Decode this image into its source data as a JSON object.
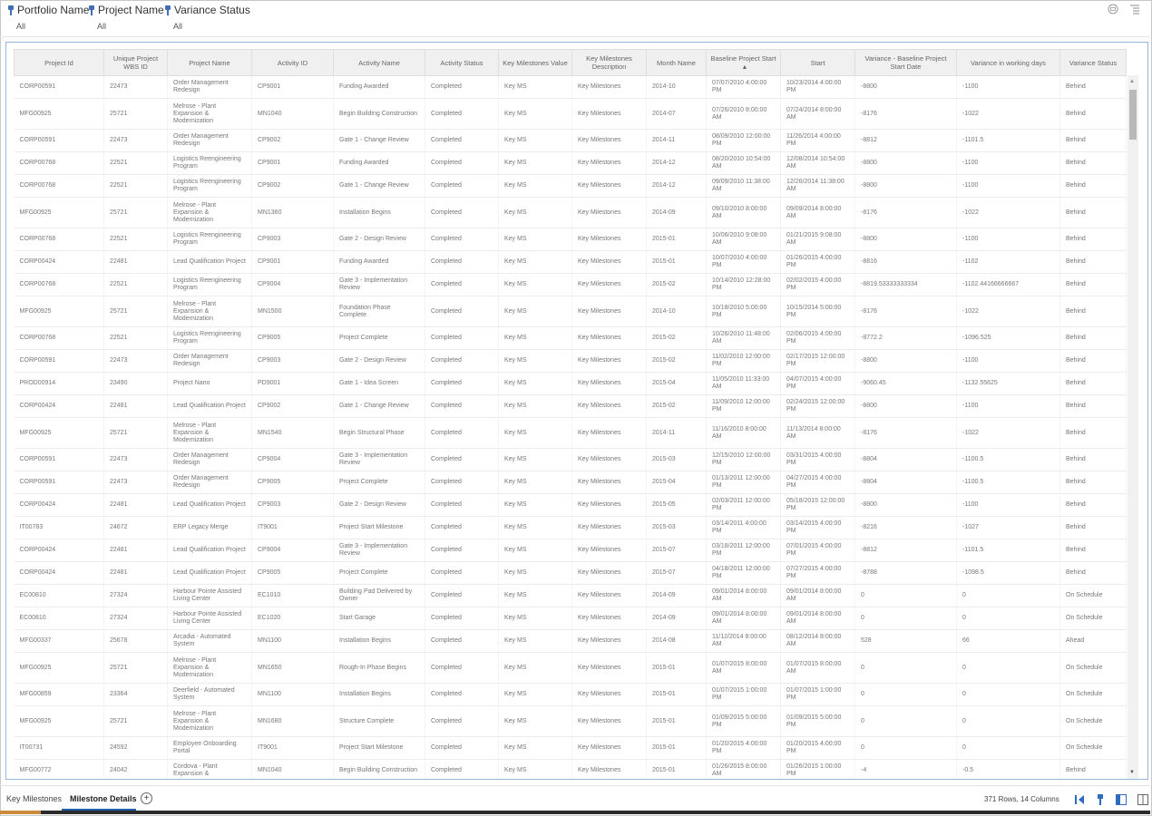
{
  "filters": [
    {
      "label": "Portfolio Name",
      "value": "All"
    },
    {
      "label": "Project Name",
      "value": "All"
    },
    {
      "label": "Variance Status",
      "value": "All"
    }
  ],
  "grid": {
    "columns": [
      "Project Id",
      "Unique Project WBS ID",
      "Project Name",
      "Activity ID",
      "Activity Name",
      "Activity Status",
      "Key Milestones Value",
      "Key Milestones Description",
      "Month Name",
      "Baseline Project Start",
      "Start",
      "Variance - Baseline Project Start Date",
      "Variance in working days",
      "Variance Status"
    ],
    "sorted_column": "Baseline Project Start",
    "rows": [
      [
        "CORP00591",
        "22473",
        "Order Management Redesign",
        "CP9001",
        "Funding Awarded",
        "Completed",
        "Key MS",
        "Key Milestones",
        "2014-10",
        "07/07/2010 4:00:00 PM",
        "10/23/2014 4:00:00 PM",
        "-8800",
        "-1100",
        "Behind"
      ],
      [
        "MFG00925",
        "25721",
        "Melrose - Plant Expansion & Modernization",
        "MN1040",
        "Begin Building Construction",
        "Completed",
        "Key MS",
        "Key Milestones",
        "2014-07",
        "07/26/2010 8:00:00 AM",
        "07/24/2014 8:00:00 AM",
        "-8176",
        "-1022",
        "Behind"
      ],
      [
        "CORP00591",
        "22473",
        "Order Management Redesign",
        "CP9002",
        "Gate 1 - Change Review",
        "Completed",
        "Key MS",
        "Key Milestones",
        "2014-11",
        "08/09/2010 12:00:00 PM",
        "11/26/2014 4:00:00 PM",
        "-8812",
        "-1101.5",
        "Behind"
      ],
      [
        "CORP00768",
        "22521",
        "Logistics Reengineering Program",
        "CP9001",
        "Funding Awarded",
        "Completed",
        "Key MS",
        "Key Milestones",
        "2014-12",
        "08/20/2010 10:54:00 AM",
        "12/08/2014 10:54:00 AM",
        "-8800",
        "-1100",
        "Behind"
      ],
      [
        "CORP00768",
        "22521",
        "Logistics Reengineering Program",
        "CP9002",
        "Gate 1 - Change Review",
        "Completed",
        "Key MS",
        "Key Milestones",
        "2014-12",
        "09/09/2010 11:38:00 AM",
        "12/26/2014 11:38:00 AM",
        "-8800",
        "-1100",
        "Behind"
      ],
      [
        "MFG00925",
        "25721",
        "Melrose - Plant Expansion & Modernization",
        "MN1360",
        "Installation Begins",
        "Completed",
        "Key MS",
        "Key Milestones",
        "2014-09",
        "09/10/2010 8:00:00 AM",
        "09/09/2014 8:00:00 AM",
        "-8176",
        "-1022",
        "Behind"
      ],
      [
        "CORP00768",
        "22521",
        "Logistics Reengineering Program",
        "CP9003",
        "Gate 2 - Design Review",
        "Completed",
        "Key MS",
        "Key Milestones",
        "2015-01",
        "10/06/2010 9:08:00 AM",
        "01/21/2015 9:08:00 AM",
        "-8800",
        "-1100",
        "Behind"
      ],
      [
        "CORP00424",
        "22481",
        "Lead Qualification Project",
        "CP9001",
        "Funding Awarded",
        "Completed",
        "Key MS",
        "Key Milestones",
        "2015-01",
        "10/07/2010 4:00:00 PM",
        "01/26/2015 4:00:00 PM",
        "-8816",
        "-1102",
        "Behind"
      ],
      [
        "CORP00768",
        "22521",
        "Logistics Reengineering Program",
        "CP9004",
        "Gate 3 - Implementation Review",
        "Completed",
        "Key MS",
        "Key Milestones",
        "2015-02",
        "10/14/2010 12:28:00 PM",
        "02/02/2015 4:00:00 PM",
        "-8819.53333333334",
        "-1102.44166666667",
        "Behind"
      ],
      [
        "MFG00925",
        "25721",
        "Melrose - Plant Expansion & Modernization",
        "MN1500",
        "Foundation Phase Complete",
        "Completed",
        "Key MS",
        "Key Milestones",
        "2014-10",
        "10/18/2010 5:00:00 PM",
        "10/15/2014 5:00:00 PM",
        "-8176",
        "-1022",
        "Behind"
      ],
      [
        "CORP00768",
        "22521",
        "Logistics Reengineering Program",
        "CP9005",
        "Project Complete",
        "Completed",
        "Key MS",
        "Key Milestones",
        "2015-02",
        "10/26/2010 11:48:00 AM",
        "02/06/2015 4:00:00 PM",
        "-8772.2",
        "-1096.525",
        "Behind"
      ],
      [
        "CORP00591",
        "22473",
        "Order Management Redesign",
        "CP9003",
        "Gate 2 - Design Review",
        "Completed",
        "Key MS",
        "Key Milestones",
        "2015-02",
        "11/02/2010 12:00:00 PM",
        "02/17/2015 12:00:00 PM",
        "-8800",
        "-1100",
        "Behind"
      ],
      [
        "PROD00914",
        "23490",
        "Project Nano",
        "PD9001",
        "Gate 1 - Idea Screen",
        "Completed",
        "Key MS",
        "Key Milestones",
        "2015-04",
        "11/05/2010 11:33:00 AM",
        "04/07/2015 4:00:00 PM",
        "-9060.45",
        "-1132.55625",
        "Behind"
      ],
      [
        "CORP00424",
        "22481",
        "Lead Qualification Project",
        "CP9002",
        "Gate 1 - Change Review",
        "Completed",
        "Key MS",
        "Key Milestones",
        "2015-02",
        "11/09/2010 12:00:00 PM",
        "02/24/2015 12:00:00 PM",
        "-8800",
        "-1100",
        "Behind"
      ],
      [
        "MFG00925",
        "25721",
        "Melrose - Plant Expansion & Modernization",
        "MN1540",
        "Begin Structural Phase",
        "Completed",
        "Key MS",
        "Key Milestones",
        "2014-11",
        "11/16/2010 8:00:00 AM",
        "11/13/2014 8:00:00 AM",
        "-8176",
        "-1022",
        "Behind"
      ],
      [
        "CORP00591",
        "22473",
        "Order Management Redesign",
        "CP9004",
        "Gate 3 - Implementation Review",
        "Completed",
        "Key MS",
        "Key Milestones",
        "2015-03",
        "12/15/2010 12:00:00 PM",
        "03/31/2015 4:00:00 PM",
        "-8804",
        "-1100.5",
        "Behind"
      ],
      [
        "CORP00591",
        "22473",
        "Order Management Redesign",
        "CP9005",
        "Project Complete",
        "Completed",
        "Key MS",
        "Key Milestones",
        "2015-04",
        "01/13/2011 12:00:00 PM",
        "04/27/2015 4:00:00 PM",
        "-8804",
        "-1100.5",
        "Behind"
      ],
      [
        "CORP00424",
        "22481",
        "Lead Qualification Project",
        "CP9003",
        "Gate 2 - Design Review",
        "Completed",
        "Key MS",
        "Key Milestones",
        "2015-05",
        "02/03/2011 12:00:00 PM",
        "05/18/2015 12:00:00 PM",
        "-8800",
        "-1100",
        "Behind"
      ],
      [
        "IT00783",
        "24672",
        "ERP Legacy Merge",
        "IT9001",
        "Project Start Milestone",
        "Completed",
        "Key MS",
        "Key Milestones",
        "2015-03",
        "03/14/2011 4:00:00 PM",
        "03/14/2015 4:00:00 PM",
        "-8216",
        "-1027",
        "Behind"
      ],
      [
        "CORP00424",
        "22481",
        "Lead Qualification Project",
        "CP9004",
        "Gate 3 - Implementation Review",
        "Completed",
        "Key MS",
        "Key Milestones",
        "2015-07",
        "03/18/2011 12:00:00 PM",
        "07/01/2015 4:00:00 PM",
        "-8812",
        "-1101.5",
        "Behind"
      ],
      [
        "CORP00424",
        "22481",
        "Lead Qualification Project",
        "CP9005",
        "Project Complete",
        "Completed",
        "Key MS",
        "Key Milestones",
        "2015-07",
        "04/18/2011 12:00:00 PM",
        "07/27/2015 4:00:00 PM",
        "-8788",
        "-1098.5",
        "Behind"
      ],
      [
        "EC00810",
        "27324",
        "Harbour Pointe Assisted Living Center",
        "EC1010",
        "Building Pad Delivered by Owner",
        "Completed",
        "Key MS",
        "Key Milestones",
        "2014-09",
        "09/01/2014 8:00:00 AM",
        "09/01/2014 8:00:00 AM",
        "0",
        "0",
        "On Schedule"
      ],
      [
        "EC00810",
        "27324",
        "Harbour Pointe Assisted Living Center",
        "EC1020",
        "Start Garage",
        "Completed",
        "Key MS",
        "Key Milestones",
        "2014-09",
        "09/01/2014 8:00:00 AM",
        "09/01/2014 8:00:00 AM",
        "0",
        "0",
        "On Schedule"
      ],
      [
        "MFG00337",
        "25678",
        "Arcadia - Automated System",
        "MN1100",
        "Installation Begins",
        "Completed",
        "Key MS",
        "Key Milestones",
        "2014-08",
        "11/12/2014 8:00:00 AM",
        "08/12/2014 8:00:00 AM",
        "528",
        "66",
        "Ahead"
      ],
      [
        "MFG00925",
        "25721",
        "Melrose - Plant Expansion & Modernization",
        "MN1650",
        "Rough-In Phase Begins",
        "Completed",
        "Key MS",
        "Key Milestones",
        "2015-01",
        "01/07/2015 8:00:00 AM",
        "01/07/2015 8:00:00 AM",
        "0",
        "0",
        "On Schedule"
      ],
      [
        "MFG00859",
        "23364",
        "Deerfield - Automated System",
        "MN1100",
        "Installation Begins",
        "Completed",
        "Key MS",
        "Key Milestones",
        "2015-01",
        "01/07/2015 1:00:00 PM",
        "01/07/2015 1:00:00 PM",
        "0",
        "0",
        "On Schedule"
      ],
      [
        "MFG00925",
        "25721",
        "Melrose - Plant Expansion & Modernization",
        "MN1680",
        "Structure Complete",
        "Completed",
        "Key MS",
        "Key Milestones",
        "2015-01",
        "01/09/2015 5:00:00 PM",
        "01/09/2015 5:00:00 PM",
        "0",
        "0",
        "On Schedule"
      ],
      [
        "IT00731",
        "24592",
        "Employee Onboarding Portal",
        "IT9001",
        "Project Start Milestone",
        "Completed",
        "Key MS",
        "Key Milestones",
        "2015-01",
        "01/20/2015 4:00:00 PM",
        "01/20/2015 4:00:00 PM",
        "0",
        "0",
        "On Schedule"
      ],
      [
        "MFG00772",
        "24042",
        "Cordova - Plant Expansion &",
        "MN1040",
        "Begin Building Construction",
        "Completed",
        "Key MS",
        "Key Milestones",
        "2015-01",
        "01/26/2015 8:00:00 AM",
        "01/26/2015 1:00:00 PM",
        "-4",
        "-0.5",
        "Behind"
      ]
    ]
  },
  "footer": {
    "tabs": [
      "Key Milestones",
      "Milestone Details"
    ],
    "active_tab": "Milestone Details",
    "add_tab_icon": "plus-circle-icon",
    "row_count": "371 Rows, 14 Columns"
  },
  "icons": {
    "top": [
      "print-icon",
      "menu-icon"
    ],
    "bottom": [
      "first-page-icon",
      "pin-icon",
      "panel-left-icon",
      "panel-split-icon"
    ]
  },
  "colors": {
    "accent": "#1f5fad",
    "pin": "#3e6fb5",
    "progress": "#c98b3c"
  }
}
